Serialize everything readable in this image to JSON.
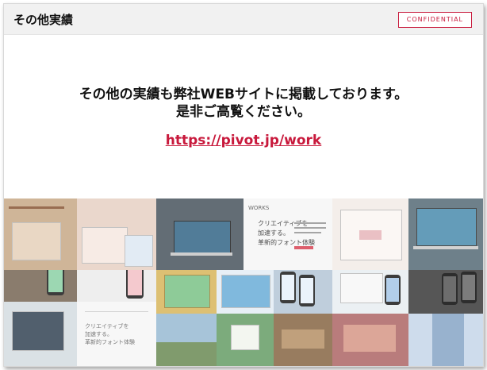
{
  "header": {
    "title": "その他実績",
    "badge": "CONFIDENTIAL"
  },
  "message": {
    "line1": "その他の実績も弊社WEBサイトに掲載しております。",
    "line2": "是非ご高覧ください。"
  },
  "link": {
    "text": "https://pivot.jp/work"
  },
  "gallery": {
    "captions": [
      "クリエイティブを",
      "加速する。",
      "革新的フォント体験"
    ]
  },
  "colors": {
    "accent": "#c8193c",
    "header_bg": "#f1f1f1"
  }
}
